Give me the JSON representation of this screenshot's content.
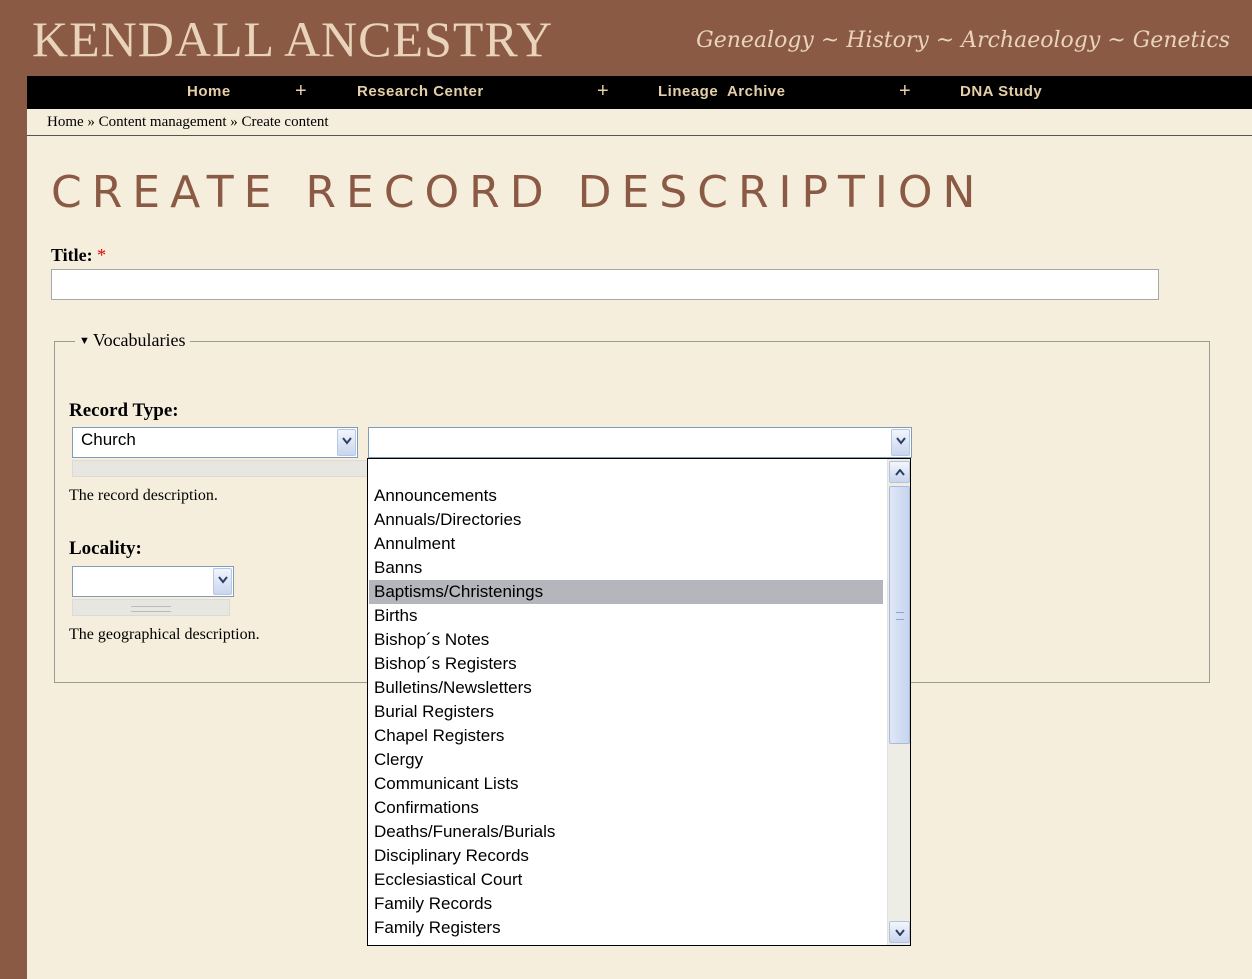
{
  "site": {
    "title": "Kendall Ancestry",
    "tagline": "Genealogy ~ History ~ Archaeology ~ Genetics"
  },
  "nav": {
    "items": [
      {
        "label": "Home"
      },
      {
        "label": "Research Center"
      },
      {
        "label": "Lineage  Archive"
      },
      {
        "label": "DNA Study"
      }
    ],
    "separator": "+"
  },
  "breadcrumb": "Home » Content management » Create content",
  "page": {
    "title": "Create Record Description"
  },
  "form": {
    "title_label": "Title:",
    "required_mark": "*",
    "title_value": "",
    "vocabularies_legend": "Vocabularies",
    "record_type": {
      "label": "Record Type:",
      "selected": "Church",
      "description": "The record description.",
      "subtype_selected": ""
    },
    "locality": {
      "label": "Locality:",
      "selected": "",
      "description": "The geographical description."
    }
  },
  "dropdown": {
    "highlighted": "Baptisms/Christenings",
    "options": [
      "",
      "Announcements",
      "Annuals/Directories",
      "Annulment",
      "Banns",
      "Baptisms/Christenings",
      "Births",
      "Bishop´s Notes",
      "Bishop´s Registers",
      "Bulletins/Newsletters",
      "Burial Registers",
      "Chapel Registers",
      "Clergy",
      "Communicant Lists",
      "Confirmations",
      "Deaths/Funerals/Burials",
      "Disciplinary Records",
      "Ecclesiastical Court",
      "Family Records",
      "Family Registers"
    ]
  },
  "colors": {
    "border_brown": "#8b5a45",
    "content_bg": "#f6eedd",
    "nav_bg": "#000000",
    "nav_text": "#e4cfa9",
    "title_color": "#8b5a45",
    "highlight": "#b5b5bc"
  }
}
